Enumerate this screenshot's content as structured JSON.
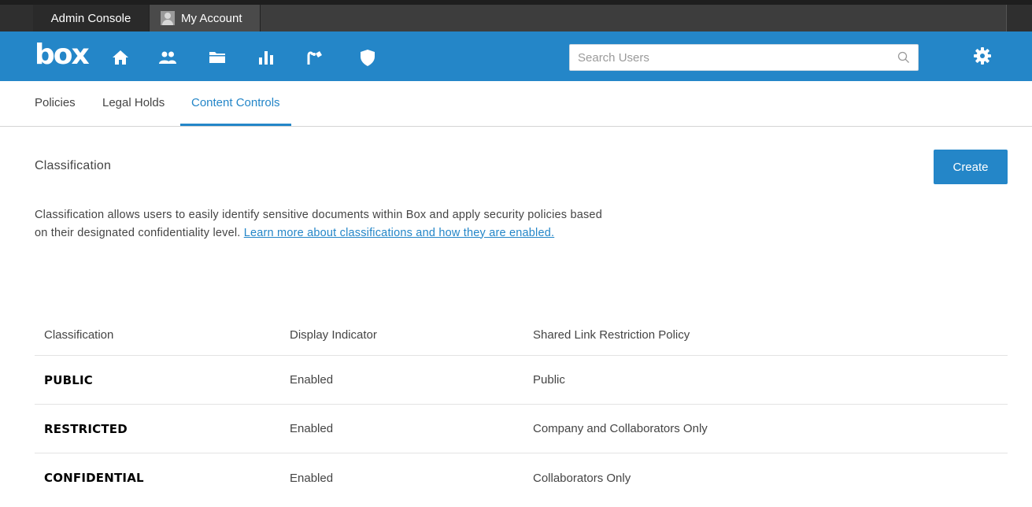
{
  "window_tabs": {
    "admin_console": "Admin Console",
    "my_account": "My Account"
  },
  "header": {
    "logo": "box",
    "nav_icons": [
      "home-icon",
      "users-icon",
      "folder-icon",
      "reports-icon",
      "apps-icon",
      "shield-icon"
    ],
    "search_placeholder": "Search Users",
    "accent_color": "#2486c8"
  },
  "subnav": {
    "tabs": [
      {
        "label": "Policies",
        "active": false
      },
      {
        "label": "Legal Holds",
        "active": false
      },
      {
        "label": "Content Controls",
        "active": true
      }
    ]
  },
  "main": {
    "section_title": "Classification",
    "create_label": "Create",
    "description_text": "Classification allows users to easily identify sensitive documents within Box and apply security policies based on their designated confidentiality level. ",
    "description_link": "Learn more about classifications and how they are enabled."
  },
  "table": {
    "columns": [
      "Classification",
      "Display Indicator",
      "Shared Link Restriction Policy"
    ],
    "rows": [
      {
        "classification": "PUBLIC",
        "display_indicator": "Enabled",
        "policy": "Public"
      },
      {
        "classification": "RESTRICTED",
        "display_indicator": "Enabled",
        "policy": "Company and Collaborators Only"
      },
      {
        "classification": "CONFIDENTIAL",
        "display_indicator": "Enabled",
        "policy": "Collaborators Only"
      }
    ]
  }
}
